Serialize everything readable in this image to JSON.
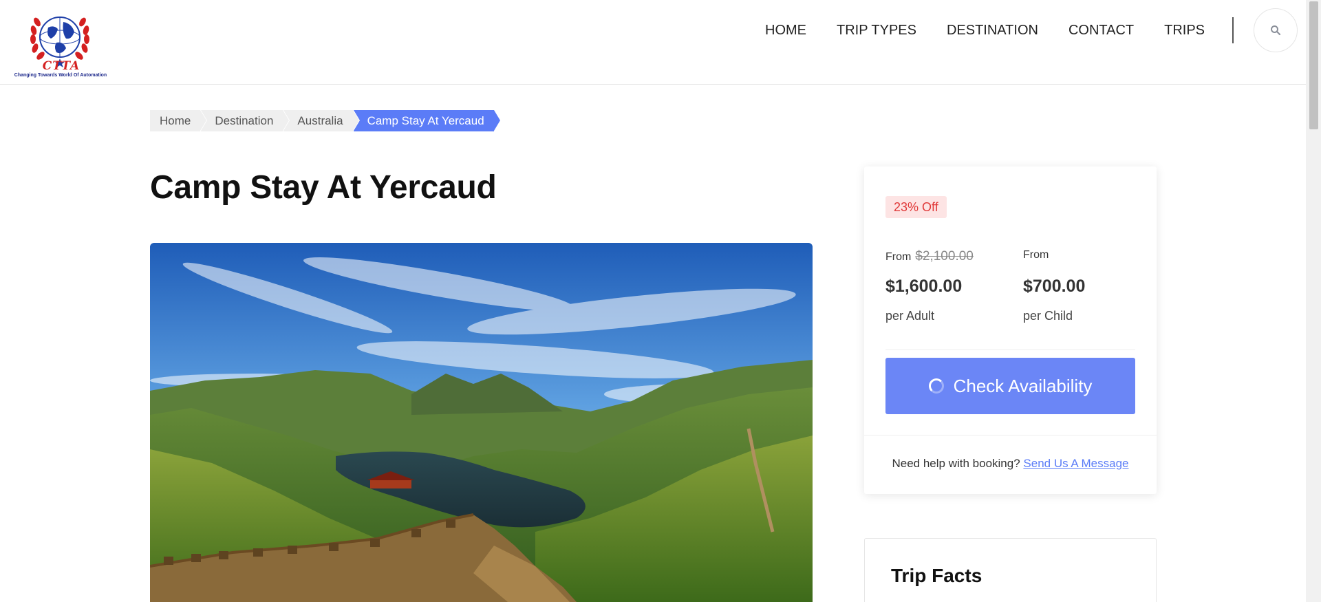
{
  "nav": {
    "items": [
      "HOME",
      "TRIP TYPES",
      "DESTINATION",
      "CONTACT",
      "TRIPS"
    ]
  },
  "logo": {
    "name": "CTTA",
    "tagline": "Changing Towards World Of Automation"
  },
  "breadcrumb": {
    "items": [
      "Home",
      "Destination",
      "Australia",
      "Camp Stay At Yercaud"
    ]
  },
  "trip": {
    "title": "Camp Stay At Yercaud"
  },
  "booking": {
    "discount": "23% Off",
    "adult": {
      "from_label": "From",
      "old_price": "$2,100.00",
      "price": "$1,600.00",
      "unit": "per Adult"
    },
    "child": {
      "from_label": "From",
      "price": "$700.00",
      "unit": "per Child"
    },
    "check_label": "Check Availability",
    "help_text": "Need help with booking?",
    "help_link": "Send Us A Message"
  },
  "facts": {
    "title": "Trip Facts"
  },
  "colors": {
    "accent": "#5b7cf7",
    "button": "#6b86f6",
    "discount_bg": "#fde4e4",
    "discount_text": "#e03a3a"
  }
}
